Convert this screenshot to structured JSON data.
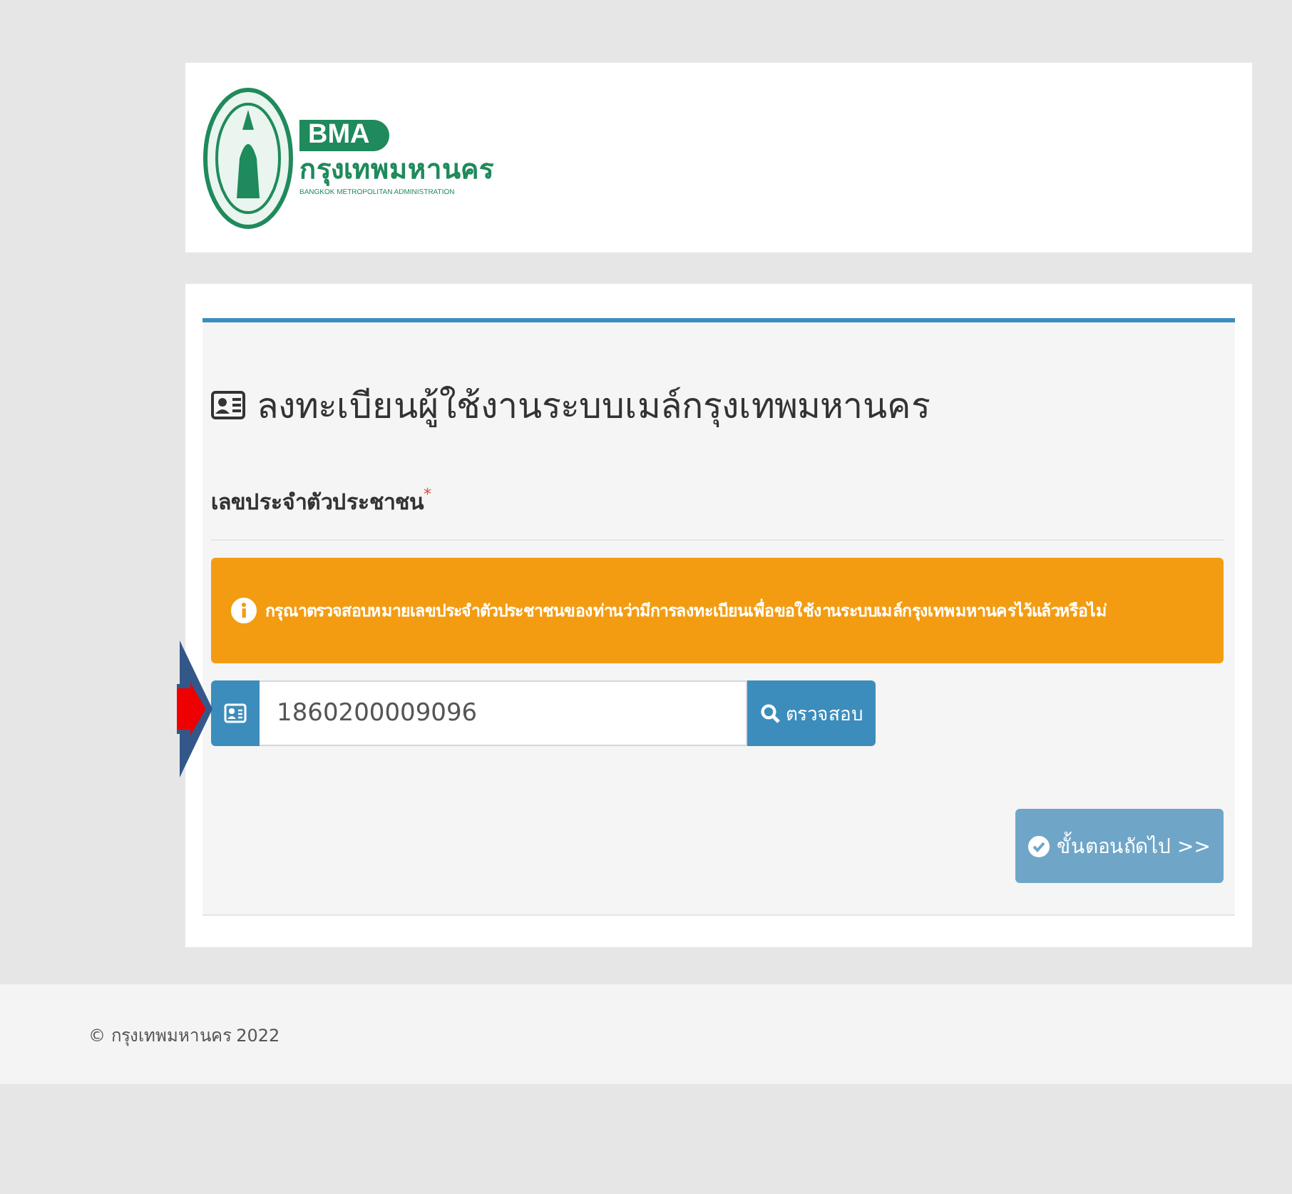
{
  "logo": {
    "abbr": "BMA",
    "name_th": "กรุงเทพมหานคร",
    "name_en": "BANGKOK METROPOLITAN ADMINISTRATION"
  },
  "form": {
    "title": "ลงทะเบียนผู้ใช้งานระบบเมล์กรุงเทพมหานคร",
    "field_label": "เลขประจำตัวประชาชน",
    "required_mark": "*",
    "alert": "กรุณาตรวจสอบหมายเลขประจำตัวประชาชนของท่านว่ามีการลงทะเบียนเพื่อขอใช้งานระบบเมล์กรุงเทพมหานครไว้แล้วหรือไม่",
    "id_value": "1860200009096",
    "check_button": "ตรวจสอบ",
    "next_button": {
      "label": "ขั้นตอนถัดไป >>",
      "disabled": true
    }
  },
  "footer": "© กรุงเทพมหานคร 2022"
}
